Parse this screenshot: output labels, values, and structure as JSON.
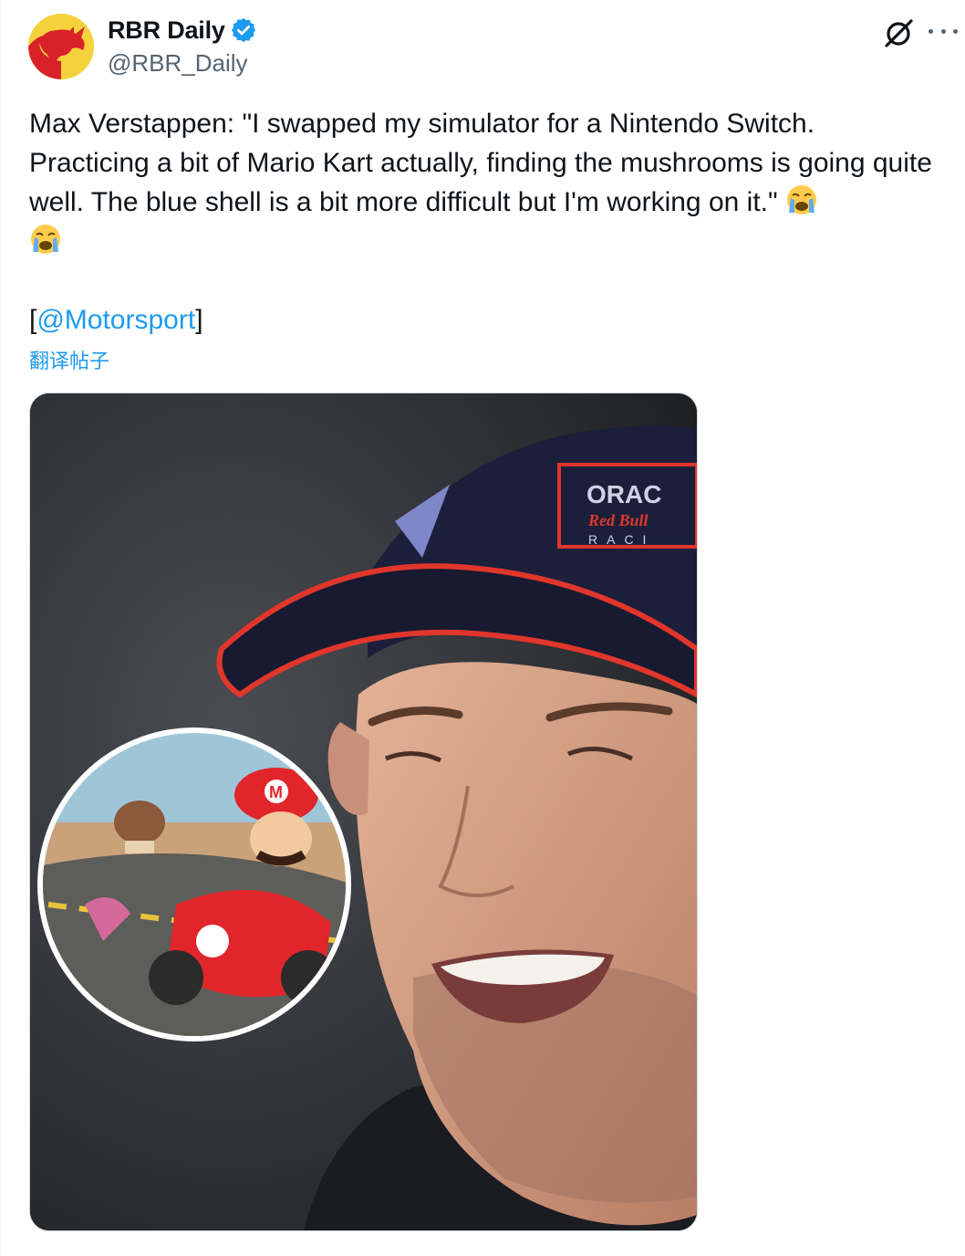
{
  "author": {
    "display_name": "RBR Daily",
    "handle": "@RBR_Daily",
    "verified": true,
    "avatar_icon": "red-bull-logo-icon",
    "avatar_bg": "#f4d23c"
  },
  "tweet": {
    "text": "Max Verstappen: \"I swapped my simulator for a Nintendo Switch. Practicing a bit of Mario Kart actually, finding the mushrooms is going quite well. The blue shell is a bit more difficult but I'm working on it.\"",
    "emoji": "loudly-crying-face-icon",
    "mention_open": "[",
    "mention": "@Motorsport",
    "mention_close": "]",
    "translate_label": "翻译帖子"
  },
  "actions": {
    "grok_icon": "grok-icon",
    "more_icon": "more-options-icon"
  },
  "media": {
    "kind": "photo",
    "inset_icon": "mario-kart-inset"
  },
  "colors": {
    "link": "#1d9bf0",
    "text": "#0f1419",
    "secondary": "#536471",
    "verified": "#1d9bf0"
  }
}
